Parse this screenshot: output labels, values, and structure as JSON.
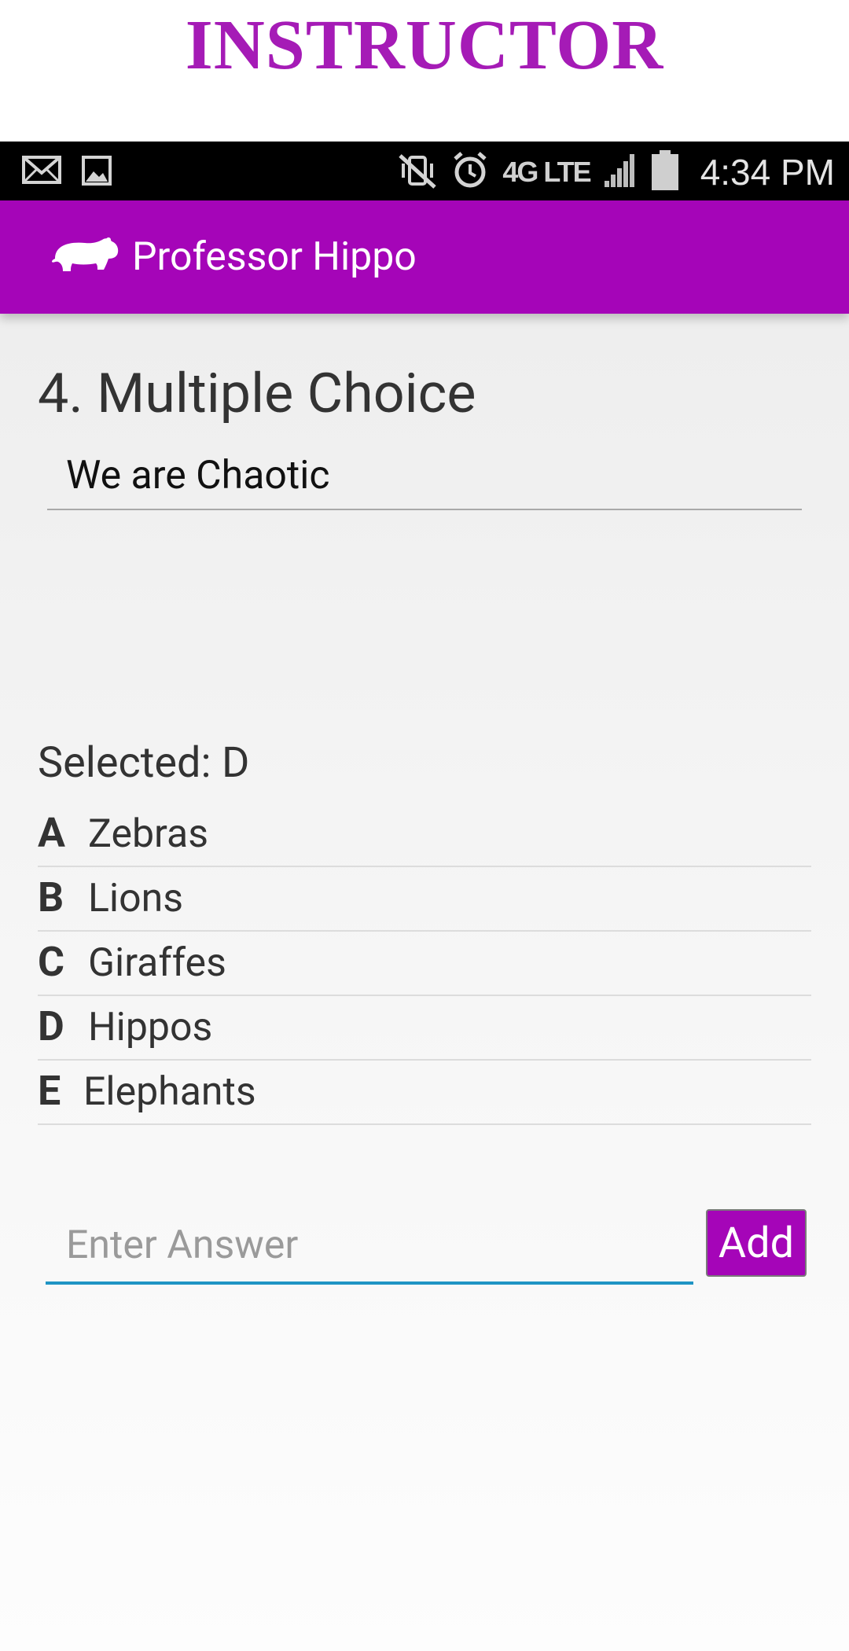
{
  "banner": {
    "title": "INSTRUCTOR",
    "color": "#a51bb6"
  },
  "status_bar": {
    "left_icons": [
      "mail-icon",
      "image-icon"
    ],
    "right_icons": [
      "mute-vibrate-icon",
      "alarm-icon",
      "signal-icon",
      "battery-icon"
    ],
    "network": "4G LTE",
    "time": "4:34 PM"
  },
  "app_bar": {
    "title": "Professor Hippo",
    "logo_icon": "hippo-icon",
    "color": "#a505b8"
  },
  "question": {
    "heading": "4. Multiple Choice",
    "text": "We are Chaotic"
  },
  "selected": {
    "label": "Selected: D"
  },
  "choices": [
    {
      "letter": "A",
      "text": "Zebras"
    },
    {
      "letter": "B",
      "text": "Lions"
    },
    {
      "letter": "C",
      "text": "Giraffes"
    },
    {
      "letter": "D",
      "text": "Hippos"
    },
    {
      "letter": "E",
      "text": "Elephants"
    }
  ],
  "answer_entry": {
    "placeholder": "Enter Answer",
    "add_label": "Add",
    "accent": "#1f95c4"
  }
}
